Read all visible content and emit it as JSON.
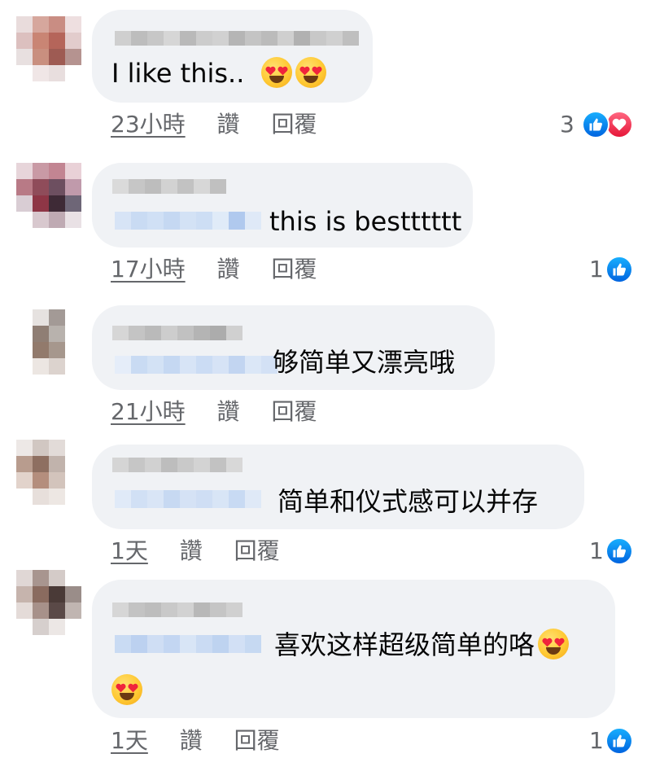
{
  "colors": {
    "bubble": "#f0f2f5",
    "meta_text": "#65676b",
    "like_blue": "#1877f2",
    "love_red": "#f02849"
  },
  "comments": [
    {
      "text": "I like this..",
      "emoji_after_text": [
        "heart-eyes-emoji",
        "heart-eyes-emoji"
      ],
      "time": "23小時",
      "like_label": "讚",
      "reply_label": "回覆",
      "reaction_count": "3",
      "reactions": [
        "like-icon",
        "love-icon"
      ]
    },
    {
      "text": "this is bestttttt",
      "time": "17小時",
      "like_label": "讚",
      "reply_label": "回覆",
      "reaction_count": "1",
      "reactions": [
        "like-icon"
      ]
    },
    {
      "text": "够简单又漂亮哦",
      "time": "21小時",
      "like_label": "讚",
      "reply_label": "回覆",
      "reaction_count": "",
      "reactions": []
    },
    {
      "text": "简单和仪式感可以并存",
      "time": "1天",
      "like_label": "讚",
      "reply_label": "回覆",
      "reaction_count": "1",
      "reactions": [
        "like-icon"
      ]
    },
    {
      "text": "喜欢这样超级简单的咯",
      "emoji_after_text": [
        "heart-eyes-emoji",
        "heart-eyes-emoji"
      ],
      "time": "1天",
      "like_label": "讚",
      "reply_label": "回覆",
      "reaction_count": "1",
      "reactions": [
        "like-icon"
      ]
    }
  ]
}
